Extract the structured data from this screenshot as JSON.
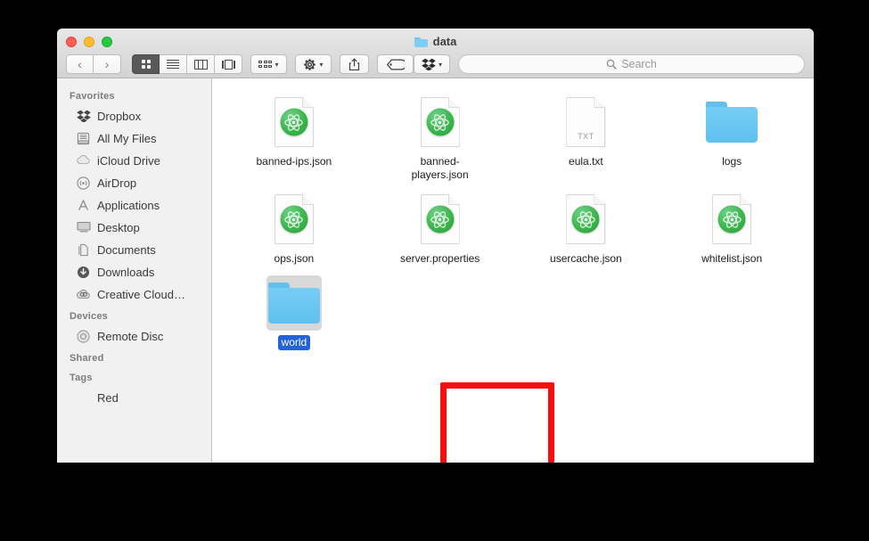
{
  "window": {
    "title": "data",
    "title_icon": "folder-icon",
    "traffic_lights": [
      "close",
      "minimize",
      "zoom"
    ]
  },
  "toolbar": {
    "back_label": "‹",
    "forward_label": "›",
    "view_modes": [
      {
        "name": "icon-view",
        "label": "Icon view",
        "active": true
      },
      {
        "name": "list-view",
        "label": "List view",
        "active": false
      },
      {
        "name": "column-view",
        "label": "Column view",
        "active": false
      },
      {
        "name": "coverflow-view",
        "label": "Cover Flow view",
        "active": false
      }
    ],
    "arrange_label": "Arrange",
    "action_label": "Action",
    "share_label": "Share",
    "tag_label": "Edit Tags",
    "dropbox_label": "Dropbox",
    "caret": "⌄"
  },
  "search": {
    "placeholder": "Search",
    "value": ""
  },
  "sidebar": {
    "sections": [
      {
        "header": "Favorites",
        "items": [
          {
            "label": "Dropbox",
            "icon": "dropbox-icon"
          },
          {
            "label": "All My Files",
            "icon": "all-my-files-icon"
          },
          {
            "label": "iCloud Drive",
            "icon": "icloud-icon"
          },
          {
            "label": "AirDrop",
            "icon": "airdrop-icon"
          },
          {
            "label": "Applications",
            "icon": "applications-icon"
          },
          {
            "label": "Desktop",
            "icon": "desktop-icon"
          },
          {
            "label": "Documents",
            "icon": "documents-icon"
          },
          {
            "label": "Downloads",
            "icon": "downloads-icon"
          },
          {
            "label": "Creative Cloud…",
            "icon": "creative-cloud-icon"
          }
        ]
      },
      {
        "header": "Devices",
        "items": [
          {
            "label": "Remote Disc",
            "icon": "remote-disc-icon"
          }
        ]
      },
      {
        "header": "Shared",
        "items": []
      },
      {
        "header": "Tags",
        "items": [
          {
            "label": "Red",
            "icon": "red-tag-icon"
          }
        ]
      }
    ]
  },
  "content": {
    "files": [
      {
        "name": "banned-ips.json",
        "type": "atom-document",
        "selected": false
      },
      {
        "name": "banned-players.json",
        "type": "atom-document",
        "selected": false
      },
      {
        "name": "eula.txt",
        "type": "text-document",
        "badge": "TXT",
        "selected": false
      },
      {
        "name": "logs",
        "type": "folder",
        "selected": false
      },
      {
        "name": "ops.json",
        "type": "atom-document",
        "selected": false
      },
      {
        "name": "server.properties",
        "type": "atom-document",
        "selected": false
      },
      {
        "name": "usercache.json",
        "type": "atom-document",
        "selected": false
      },
      {
        "name": "whitelist.json",
        "type": "atom-document",
        "selected": false
      },
      {
        "name": "world",
        "type": "folder",
        "selected": true
      }
    ]
  },
  "annotation": {
    "target": "world",
    "color": "#fb0d0d"
  },
  "colors": {
    "selection_blue": "#2362d8",
    "folder_blue": "#6ec8f2",
    "atom_green": "#3cb54c",
    "annotation_red": "#fb0d0d",
    "sidebar_bg": "#f1f1f1",
    "titlebar_bg": "#dcdcdc",
    "page_bg": "#000000"
  }
}
